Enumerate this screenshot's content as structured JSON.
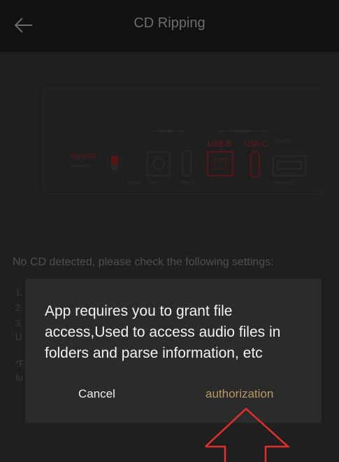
{
  "header": {
    "title": "CD Ripping",
    "back_icon": "arrow-left-icon"
  },
  "diagram": {
    "ripper_label": "RIPPER",
    "ripper_sub": "TRANSPORT",
    "dc_in_label": "DC IN",
    "ripper_group_label": "RIPPER",
    "usb_b_label": "USB-B",
    "usb_c_label": "USB-C",
    "usb_a_label": "USB-A OTG",
    "power_label": "POWER",
    "port_label_1": "DC5V",
    "port_label_2": "TYPE-C",
    "port_label_3": "USB AUDIO",
    "accent_color": "#c62828"
  },
  "notice": "No CD detected, please check the following settings:",
  "background_steps": {
    "step1": "1.",
    "step2": "2.",
    "step3": "3.",
    "step3b": "U",
    "note1": "*F",
    "note2": "fu"
  },
  "dialog": {
    "message": "App requires you to grant file access,Used to access audio files in folders and parse information, etc",
    "cancel_label": "Cancel",
    "authorize_label": "authorization",
    "accent_color": "#b79a66"
  },
  "annotation": {
    "arrow_icon": "up-arrow-annotation-icon",
    "color": "#e0302a"
  }
}
